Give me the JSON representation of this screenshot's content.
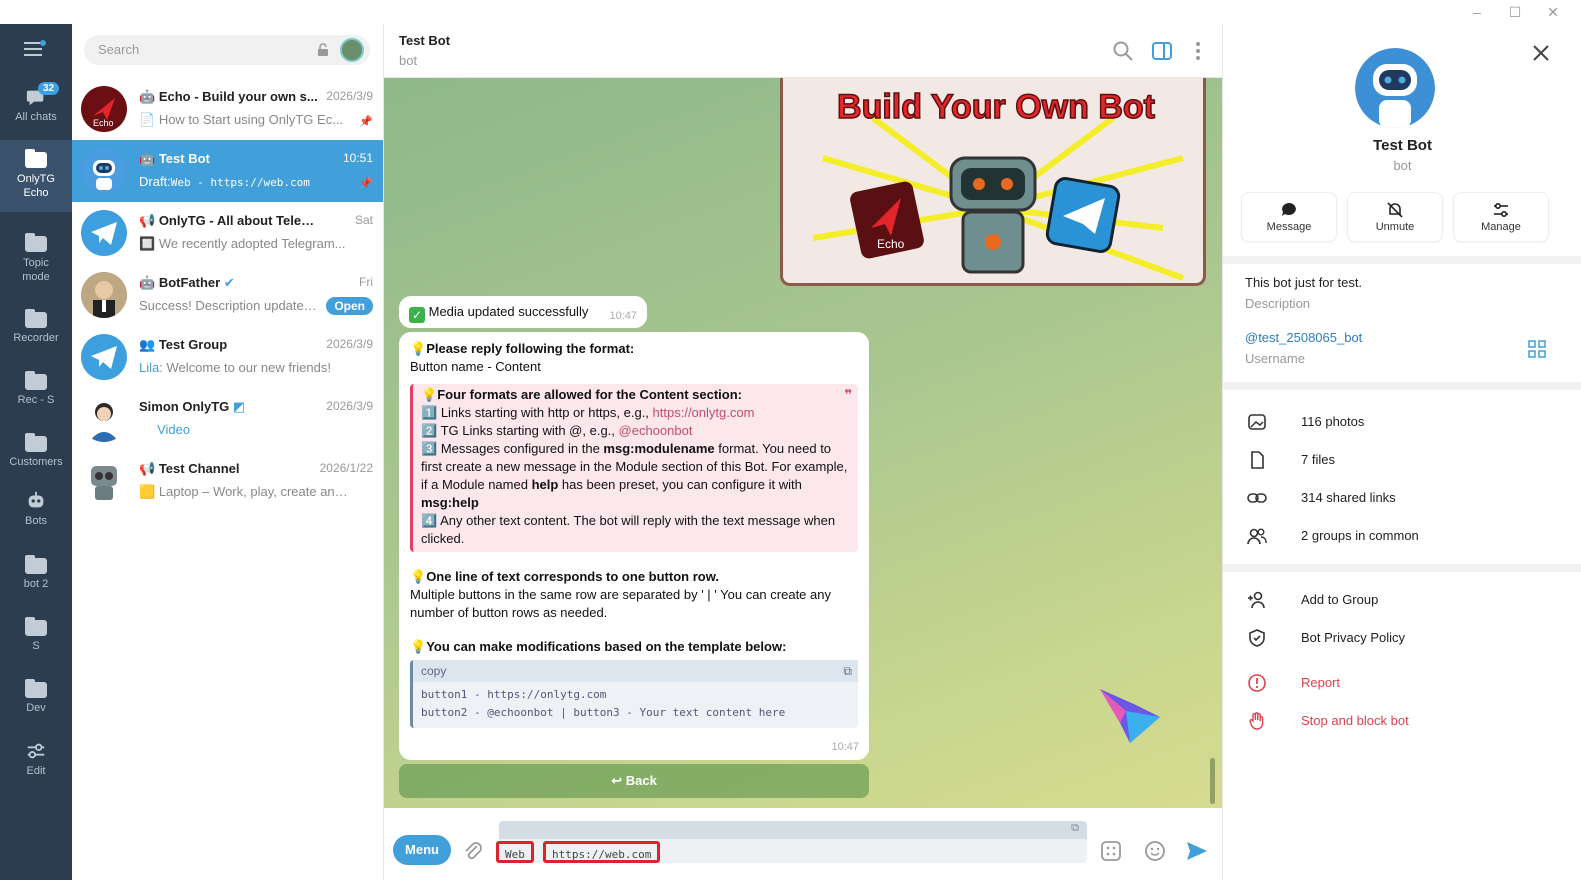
{
  "window": {
    "minimize": "–",
    "maximize": "☐",
    "close": "✕"
  },
  "folders": [
    {
      "label": "All chats",
      "badge": "32"
    },
    {
      "label": "OnlyTG Echo"
    },
    {
      "label": "Topic mode"
    },
    {
      "label": "Recorder"
    },
    {
      "label": "Rec - S"
    },
    {
      "label": "Customers"
    },
    {
      "label": "Bots"
    },
    {
      "label": "bot 2"
    },
    {
      "label": "S"
    },
    {
      "label": "Dev"
    },
    {
      "label": "Edit"
    }
  ],
  "search": {
    "placeholder": "Search"
  },
  "chats": [
    {
      "name": "Echo - Build your own s...",
      "time": "2026/3/9",
      "preview": "How to Start using OnlyTG Ec..."
    },
    {
      "name": "Test Bot",
      "time": "10:51",
      "preview_label": "Draft:",
      "preview": "Web - https://web.com"
    },
    {
      "name": "OnlyTG - All about Telegram",
      "time": "Sat",
      "preview": "We recently adopted Telegram..."
    },
    {
      "name": "BotFather",
      "time": "Fri",
      "preview": "Success! Description updated...",
      "action": "Open"
    },
    {
      "name": "Test Group",
      "time": "2026/3/9",
      "preview_sender": "Lila:",
      "preview": "Welcome to our new friends!"
    },
    {
      "name": "Simon OnlyTG",
      "time": "2026/3/9",
      "preview": "Video"
    },
    {
      "name": "Test Channel",
      "time": "2026/1/22",
      "preview": "Laptop – Work, play, create anywh..."
    }
  ],
  "chat": {
    "title": "Test Bot",
    "subtitle": "bot",
    "image_caption": "Build Your Own Bot",
    "image_badge": "Echo",
    "status_msg": {
      "text": "Media updated successfully",
      "time": "10:47"
    },
    "main_msg": {
      "h1": "Please reply following the format:",
      "l1": "Button name - Content",
      "q_title": "Four formats are allowed for the Content section:",
      "q1a": "Links starting with http or https, e.g., ",
      "q1b": "https://onlytg.com",
      "q2a": "TG Links starting with @, e.g., ",
      "q2b": "@echoonbot",
      "q3a": "Messages configured in the ",
      "q3b": "msg:modulename",
      "q3c": " format. You need to first create a new message in the Module section of this Bot. For example, if a Module named ",
      "q3d": "help",
      "q3e": " has been preset, you can configure it with ",
      "q3f": "msg:help",
      "q4": "Any other text content. The bot will reply with the text message when clicked.",
      "h2": "One line of text corresponds to one button row.",
      "l2": "Multiple buttons in the same row are separated by ' | ' You can create any number of button rows as needed.",
      "h3": "You can make modifications based on the template below:",
      "code_label": "copy",
      "code1": "button1 - https://onlytg.com",
      "code2": "button2 - @echoonbot | button3 - Your text content here",
      "time": "10:47"
    },
    "back_button": "Back"
  },
  "composer": {
    "menu": "Menu",
    "token1": "Web",
    "token2": "https://web.com"
  },
  "profile": {
    "name": "Test Bot",
    "subtitle": "bot",
    "actions": [
      "Message",
      "Unmute",
      "Manage"
    ],
    "description": "This bot just for test.",
    "description_label": "Description",
    "username": "@test_2508065_bot",
    "username_label": "Username",
    "media": [
      "116 photos",
      "7 files",
      "314 shared links",
      "2 groups in common"
    ],
    "options": [
      "Add to Group",
      "Bot Privacy Policy"
    ],
    "danger": [
      "Report",
      "Stop and block bot"
    ]
  },
  "colors": {
    "accent": "#419fd9",
    "sidebar": "#2b3d4f",
    "danger": "#d9434b",
    "highlight": "#d9232d"
  }
}
